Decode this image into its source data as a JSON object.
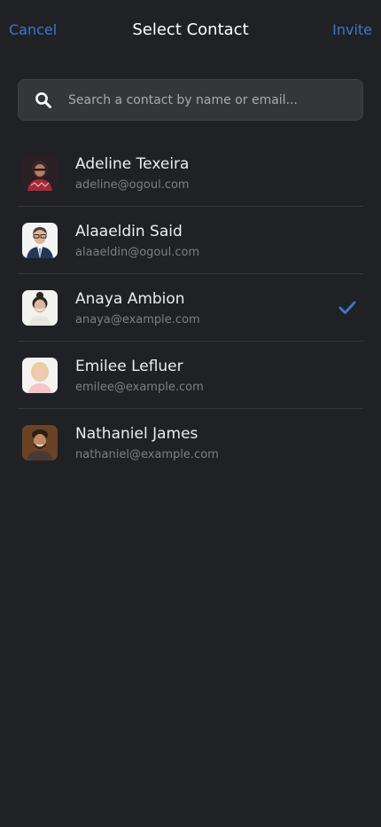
{
  "nav": {
    "cancel": "Cancel",
    "title": "Select Contact",
    "invite": "Invite"
  },
  "search": {
    "placeholder": "Search a contact by name or email...",
    "value": "",
    "icon": "search-icon"
  },
  "colors": {
    "background": "#202124",
    "accent": "#3a78d4",
    "search_bg": "#35363a",
    "divider": "#37383c"
  },
  "contacts": [
    {
      "name": "Adeline Texeira",
      "email": "adeline@ogoul.com",
      "selected": false
    },
    {
      "name": "Alaaeldin Said",
      "email": "alaaeldin@ogoul.com",
      "selected": false
    },
    {
      "name": "Anaya Ambion",
      "email": "anaya@example.com",
      "selected": true
    },
    {
      "name": "Emilee Lefluer",
      "email": "emilee@example.com",
      "selected": false
    },
    {
      "name": "Nathaniel James",
      "email": "nathaniel@example.com",
      "selected": false
    }
  ]
}
